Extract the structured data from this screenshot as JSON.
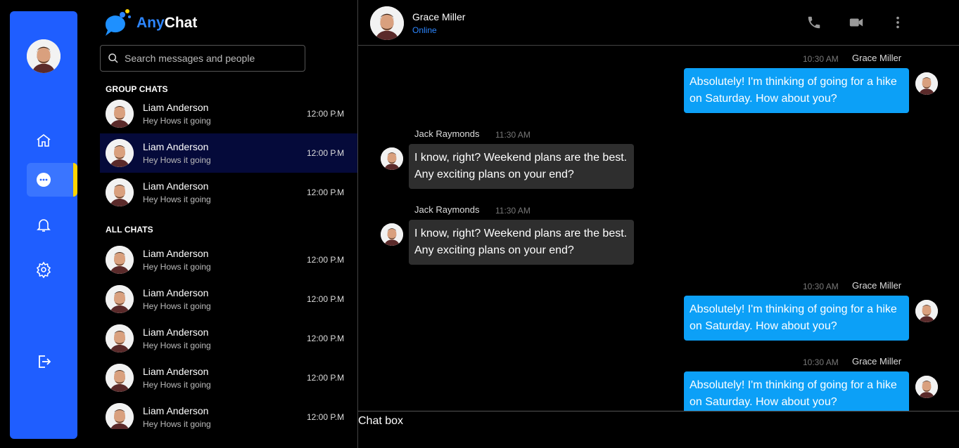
{
  "app": {
    "logo_part1": "Any",
    "logo_part2": "Chat",
    "accent": "#1f5eff",
    "bubble_out": "#0ca0f7",
    "bubble_in": "#2e2e2e"
  },
  "rail": {
    "items": [
      {
        "icon": "home-icon"
      },
      {
        "icon": "chat-icon",
        "active": true
      },
      {
        "icon": "bell-icon"
      },
      {
        "icon": "gear-icon"
      },
      {
        "icon": "logout-icon"
      }
    ]
  },
  "search": {
    "placeholder": "Search messages and people"
  },
  "groups": {
    "title": "GROUP CHATS",
    "items": [
      {
        "name": "Liam Anderson",
        "preview": "Hey Hows it going",
        "time": "12:00 P.M"
      },
      {
        "name": "Liam Anderson",
        "preview": "Hey Hows it going",
        "time": "12:00 P.M"
      },
      {
        "name": "Liam Anderson",
        "preview": "Hey Hows it going",
        "time": "12:00 P.M"
      }
    ]
  },
  "all": {
    "title": "ALL CHATS",
    "items": [
      {
        "name": "Liam Anderson",
        "preview": "Hey Hows it going",
        "time": "12:00 P.M"
      },
      {
        "name": "Liam Anderson",
        "preview": "Hey Hows it going",
        "time": "12:00 P.M"
      },
      {
        "name": "Liam Anderson",
        "preview": "Hey Hows it going",
        "time": "12:00 P.M"
      },
      {
        "name": "Liam Anderson",
        "preview": "Hey Hows it going",
        "time": "12:00 P.M"
      },
      {
        "name": "Liam Anderson",
        "preview": "Hey Hows it going",
        "time": "12:00 P.M"
      }
    ]
  },
  "conversation": {
    "contact": "Grace Miller",
    "status": "Online",
    "messages": [
      {
        "dir": "out",
        "sender": "Grace Miller",
        "time": "10:30 AM",
        "text": "Absolutely! I'm thinking of going for a hike on Saturday. How about you?"
      },
      {
        "dir": "in",
        "sender": "Jack Raymonds",
        "time": "11:30 AM",
        "text": "I know, right? Weekend plans are the best. Any exciting plans on your end?"
      },
      {
        "dir": "in",
        "sender": "Jack Raymonds",
        "time": "11:30 AM",
        "text": "I know, right? Weekend plans are the best. Any exciting plans on your end?"
      },
      {
        "dir": "out",
        "sender": "Grace Miller",
        "time": "10:30 AM",
        "text": "Absolutely! I'm thinking of going for a hike on Saturday. How about you?"
      },
      {
        "dir": "out",
        "sender": "Grace Miller",
        "time": "10:30 AM",
        "text": "Absolutely! I'm thinking of going for a hike on Saturday. How about you?"
      }
    ]
  },
  "composer": {
    "placeholder": "Chat box"
  }
}
